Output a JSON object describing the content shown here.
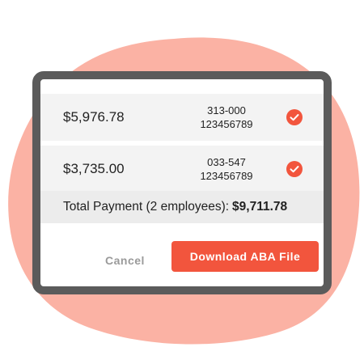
{
  "colors": {
    "background_blob": "#fbb2a4",
    "frame": "#5b5b5b",
    "accent": "#f2553d",
    "row_bg": "#f3f3f3",
    "total_bg": "#ececec"
  },
  "payments": [
    {
      "amount": "$5,976.78",
      "bsb": "313-000",
      "account": "123456789",
      "icon": "check-circle-icon"
    },
    {
      "amount": "$3,735.00",
      "bsb": "033-547",
      "account": "123456789",
      "icon": "check-circle-icon"
    }
  ],
  "total": {
    "label": "Total Payment (2 employees):",
    "value": "$9,711.78"
  },
  "actions": {
    "cancel_label": "Cancel",
    "download_label": "Download ABA File"
  }
}
